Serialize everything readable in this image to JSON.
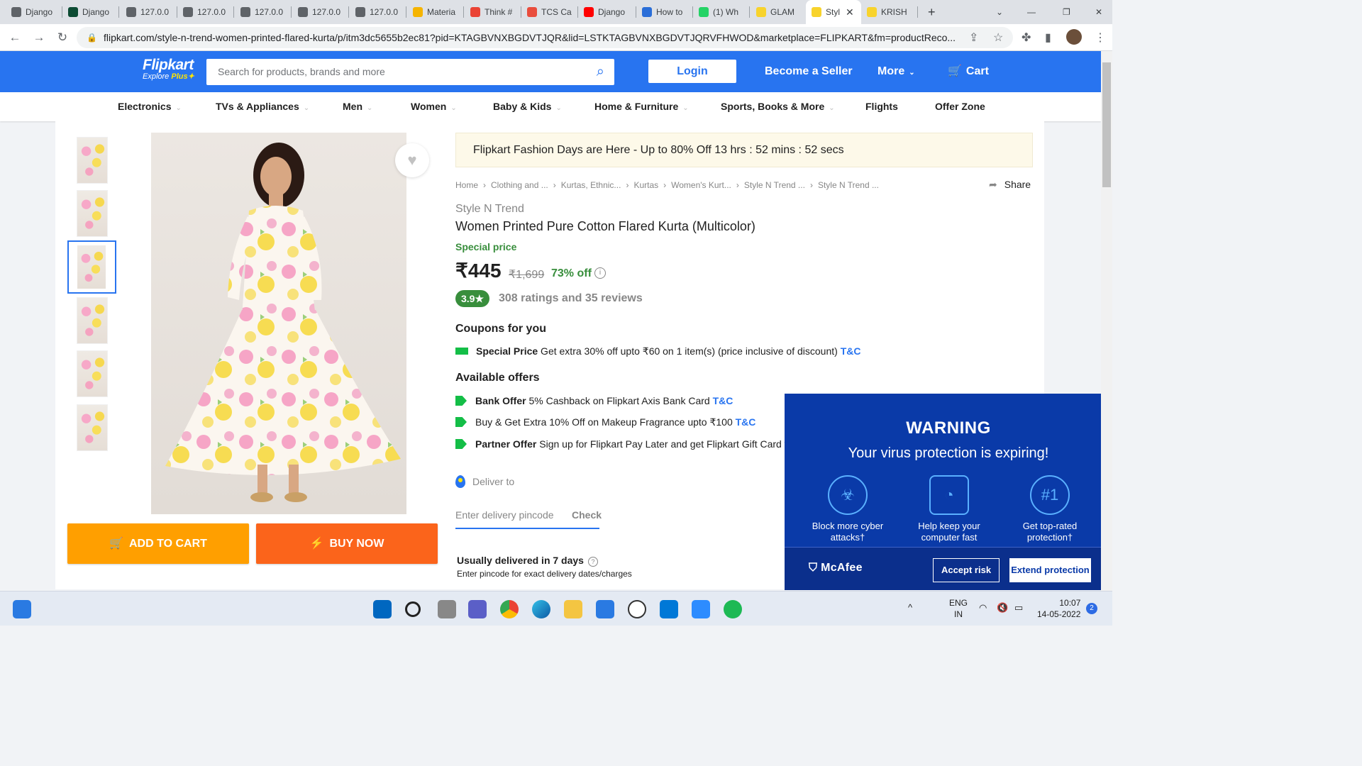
{
  "browser": {
    "tabs": [
      {
        "label": "Django",
        "icon": "lightbulb-icon",
        "color": "#5f6368"
      },
      {
        "label": "Django",
        "icon": "django-icon",
        "color": "#0c4b33"
      },
      {
        "label": "127.0.0",
        "icon": "globe-icon",
        "color": "#5f6368"
      },
      {
        "label": "127.0.0",
        "icon": "globe-icon",
        "color": "#5f6368"
      },
      {
        "label": "127.0.0",
        "icon": "globe-icon",
        "color": "#5f6368"
      },
      {
        "label": "127.0.0",
        "icon": "globe-icon",
        "color": "#5f6368"
      },
      {
        "label": "127.0.0",
        "icon": "spinner-icon",
        "color": "#5f6368"
      },
      {
        "label": "Materia",
        "icon": "materialize-icon",
        "color": "#f5b400"
      },
      {
        "label": "Think #",
        "icon": "gmail-icon",
        "color": "#ea4335"
      },
      {
        "label": "TCS Ca",
        "icon": "tcs-icon",
        "color": "#e94d3d"
      },
      {
        "label": "Django",
        "icon": "youtube-icon",
        "color": "#ff0000"
      },
      {
        "label": "How to",
        "icon": "s-icon",
        "color": "#2a6ed8"
      },
      {
        "label": "(1) Wh",
        "icon": "whatsapp-icon",
        "color": "#25d366"
      },
      {
        "label": "GLAM",
        "icon": "flipkart-icon",
        "color": "#f8d32c"
      },
      {
        "label": "Styl",
        "icon": "flipkart-icon",
        "color": "#f8d32c",
        "active": true
      },
      {
        "label": "KRISH",
        "icon": "flipkart-icon",
        "color": "#f8d32c"
      }
    ],
    "url": "flipkart.com/style-n-trend-women-printed-flared-kurta/p/itm3dc5655b2ec81?pid=KTAGBVNXBGDVTJQR&lid=LSTKTAGBVNXBGDVTJQRVFHWOD&marketplace=FLIPKART&fm=productReco..."
  },
  "header": {
    "logo_text": "Flipkart",
    "logo_sub_prefix": "Explore ",
    "logo_sub_plus": "Plus",
    "search_placeholder": "Search for products, brands and more",
    "login": "Login",
    "become_seller": "Become a Seller",
    "more": "More",
    "cart": "Cart",
    "brand_color": "#2874f0"
  },
  "categories": [
    "Electronics",
    "TVs & Appliances",
    "Men",
    "Women",
    "Baby & Kids",
    "Home & Furniture",
    "Sports, Books & More",
    "Flights",
    "Offer Zone"
  ],
  "product": {
    "add_to_cart": "ADD TO CART",
    "buy_now": "BUY NOW",
    "promo": "Flipkart Fashion Days are Here - Up to 80% Off 13 hrs : 52 mins : 52 secs",
    "breadcrumbs": [
      "Home",
      "Clothing and ...",
      "Kurtas, Ethnic...",
      "Kurtas",
      "Women's Kurt...",
      "Style N Trend ...",
      "Style N Trend ..."
    ],
    "share": "Share",
    "brand": "Style N Trend",
    "title": "Women Printed Pure Cotton Flared Kurta  (Multicolor)",
    "special_price": "Special price",
    "price": "₹445",
    "mrp": "₹1,699",
    "discount": "73% off",
    "rating": "3.9★",
    "rating_text": "308 ratings and 35 reviews",
    "coupons_head": "Coupons for you",
    "coupon": {
      "bold": "Special Price",
      "text": " Get extra 30% off upto ₹60 on 1 item(s) (price inclusive of discount) ",
      "tnc": "T&C"
    },
    "offers_head": "Available offers",
    "offers": [
      {
        "bold": "Bank Offer",
        "text": " 5% Cashback on Flipkart Axis Bank Card ",
        "tnc": "T&C"
      },
      {
        "bold": "",
        "text": "Buy & Get Extra 10% Off on Makeup Fragrance upto ₹100 ",
        "tnc": "T&C"
      },
      {
        "bold": "Partner Offer",
        "text": " Sign up for Flipkart Pay Later and get Flipkart Gift Card w",
        "tnc": ""
      }
    ],
    "deliver_to": "Deliver to",
    "pincode_placeholder": "Enter delivery pincode",
    "check": "Check",
    "usually": "Usually delivered in 7 days",
    "enter_pin_note": "Enter pincode for exact delivery dates/charges"
  },
  "mcafee": {
    "title": "WARNING",
    "subtitle": "Your virus protection is expiring!",
    "features": [
      "Block more cyber attacks†",
      "Help keep your computer fast",
      "Get top-rated protection†"
    ],
    "logo": "McAfee",
    "accept": "Accept risk",
    "extend": "Extend protection"
  },
  "taskbar": {
    "lang1": "ENG",
    "lang2": "IN",
    "time": "10:07",
    "date": "14-05-2022",
    "notifications": "2"
  }
}
